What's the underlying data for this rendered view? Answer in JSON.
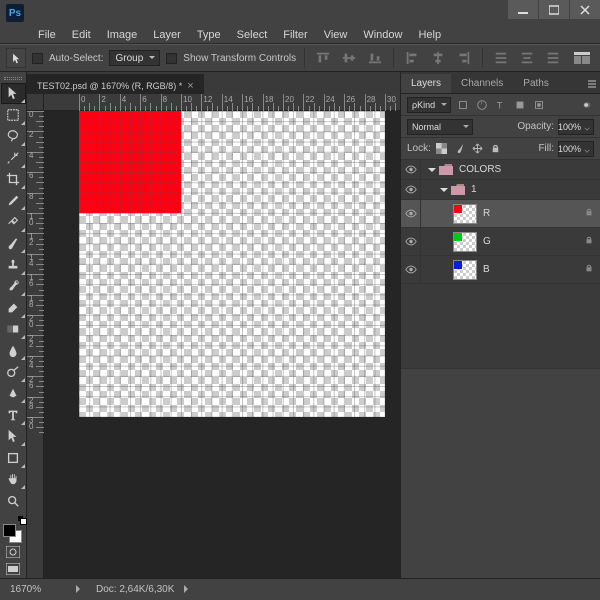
{
  "app_abbrev": "Ps",
  "menu": [
    "File",
    "Edit",
    "Image",
    "Layer",
    "Type",
    "Select",
    "Filter",
    "View",
    "Window",
    "Help"
  ],
  "options": {
    "auto_select_label": "Auto-Select:",
    "auto_select_mode": "Group",
    "show_transform_label": "Show Transform Controls"
  },
  "document": {
    "tab_title": "TEST02.psd @ 1670% (R, RGB/8) *",
    "zoom": "1670%",
    "doc_info": "Doc: 2,64K/6,30K",
    "ruler_units": [
      "0",
      "2",
      "4",
      "6",
      "8",
      "10",
      "12",
      "14",
      "16",
      "18",
      "20",
      "22",
      "24",
      "26",
      "28",
      "30"
    ]
  },
  "panels": {
    "tabs": {
      "layers": "Layers",
      "channels": "Channels",
      "paths": "Paths"
    },
    "kind_label": "Kind",
    "blend_mode": "Normal",
    "opacity_label": "Opacity:",
    "opacity_val": "100%",
    "lock_label": "Lock:",
    "fill_label": "Fill:",
    "fill_val": "100%"
  },
  "layers": {
    "group_colors": "COLORS",
    "group_1": "1",
    "r": "R",
    "g": "G",
    "b": "B"
  },
  "colors": {
    "r": "#ff0013",
    "g": "#00c71b",
    "b": "#0b1bd8"
  }
}
